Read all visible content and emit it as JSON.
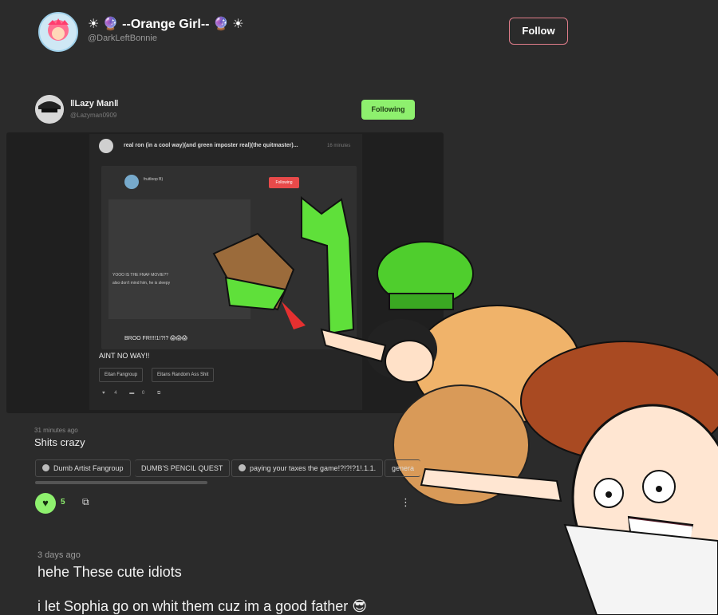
{
  "header": {
    "display_name": "☀ 🔮 --Orange Girl-- 🔮 ☀",
    "handle": "@DarkLeftBonnie",
    "follow_label": "Follow"
  },
  "embed": {
    "author_name": "‖Lazy Man‖",
    "author_handle": "@Lazyman0909",
    "following_label": "Following",
    "nested": {
      "title": "real ron (in a cool way)(and green imposter real)(the quitmaster)...",
      "time": "16 minutes",
      "inner_name": "fruitloop B)",
      "inner_btn": "Following",
      "deep_line_1": "YOOO IS THE FNAF MOVIE??",
      "deep_line_2": "also don't mind him, he is sleepy",
      "broo": "BROO FR!!!!1!?!? 😱😱😱",
      "aint": "AINT NO WAY!!",
      "tags": [
        "Eitan Fangroup",
        "Eitans Random Ass Shit"
      ],
      "likes": "4",
      "comments": "0"
    }
  },
  "post": {
    "time": "31 minutes ago",
    "text": "Shits crazy",
    "chips": [
      "Dumb Artist Fangroup",
      "DUMB'S PENCIL QUEST",
      "paying your taxes the game!?!?!?1!.1.1.",
      "genera"
    ],
    "like_count": "5"
  },
  "caption": {
    "time": "3 days ago",
    "line1": "hehe These cute idiots",
    "line2": "i let Sophia go on whit them cuz im a good father 😎"
  },
  "colors": {
    "background": "#2b2b2b",
    "accent_green": "#8ef06e",
    "follow_border": "#e07d8a",
    "red_button": "#e84a4a"
  }
}
